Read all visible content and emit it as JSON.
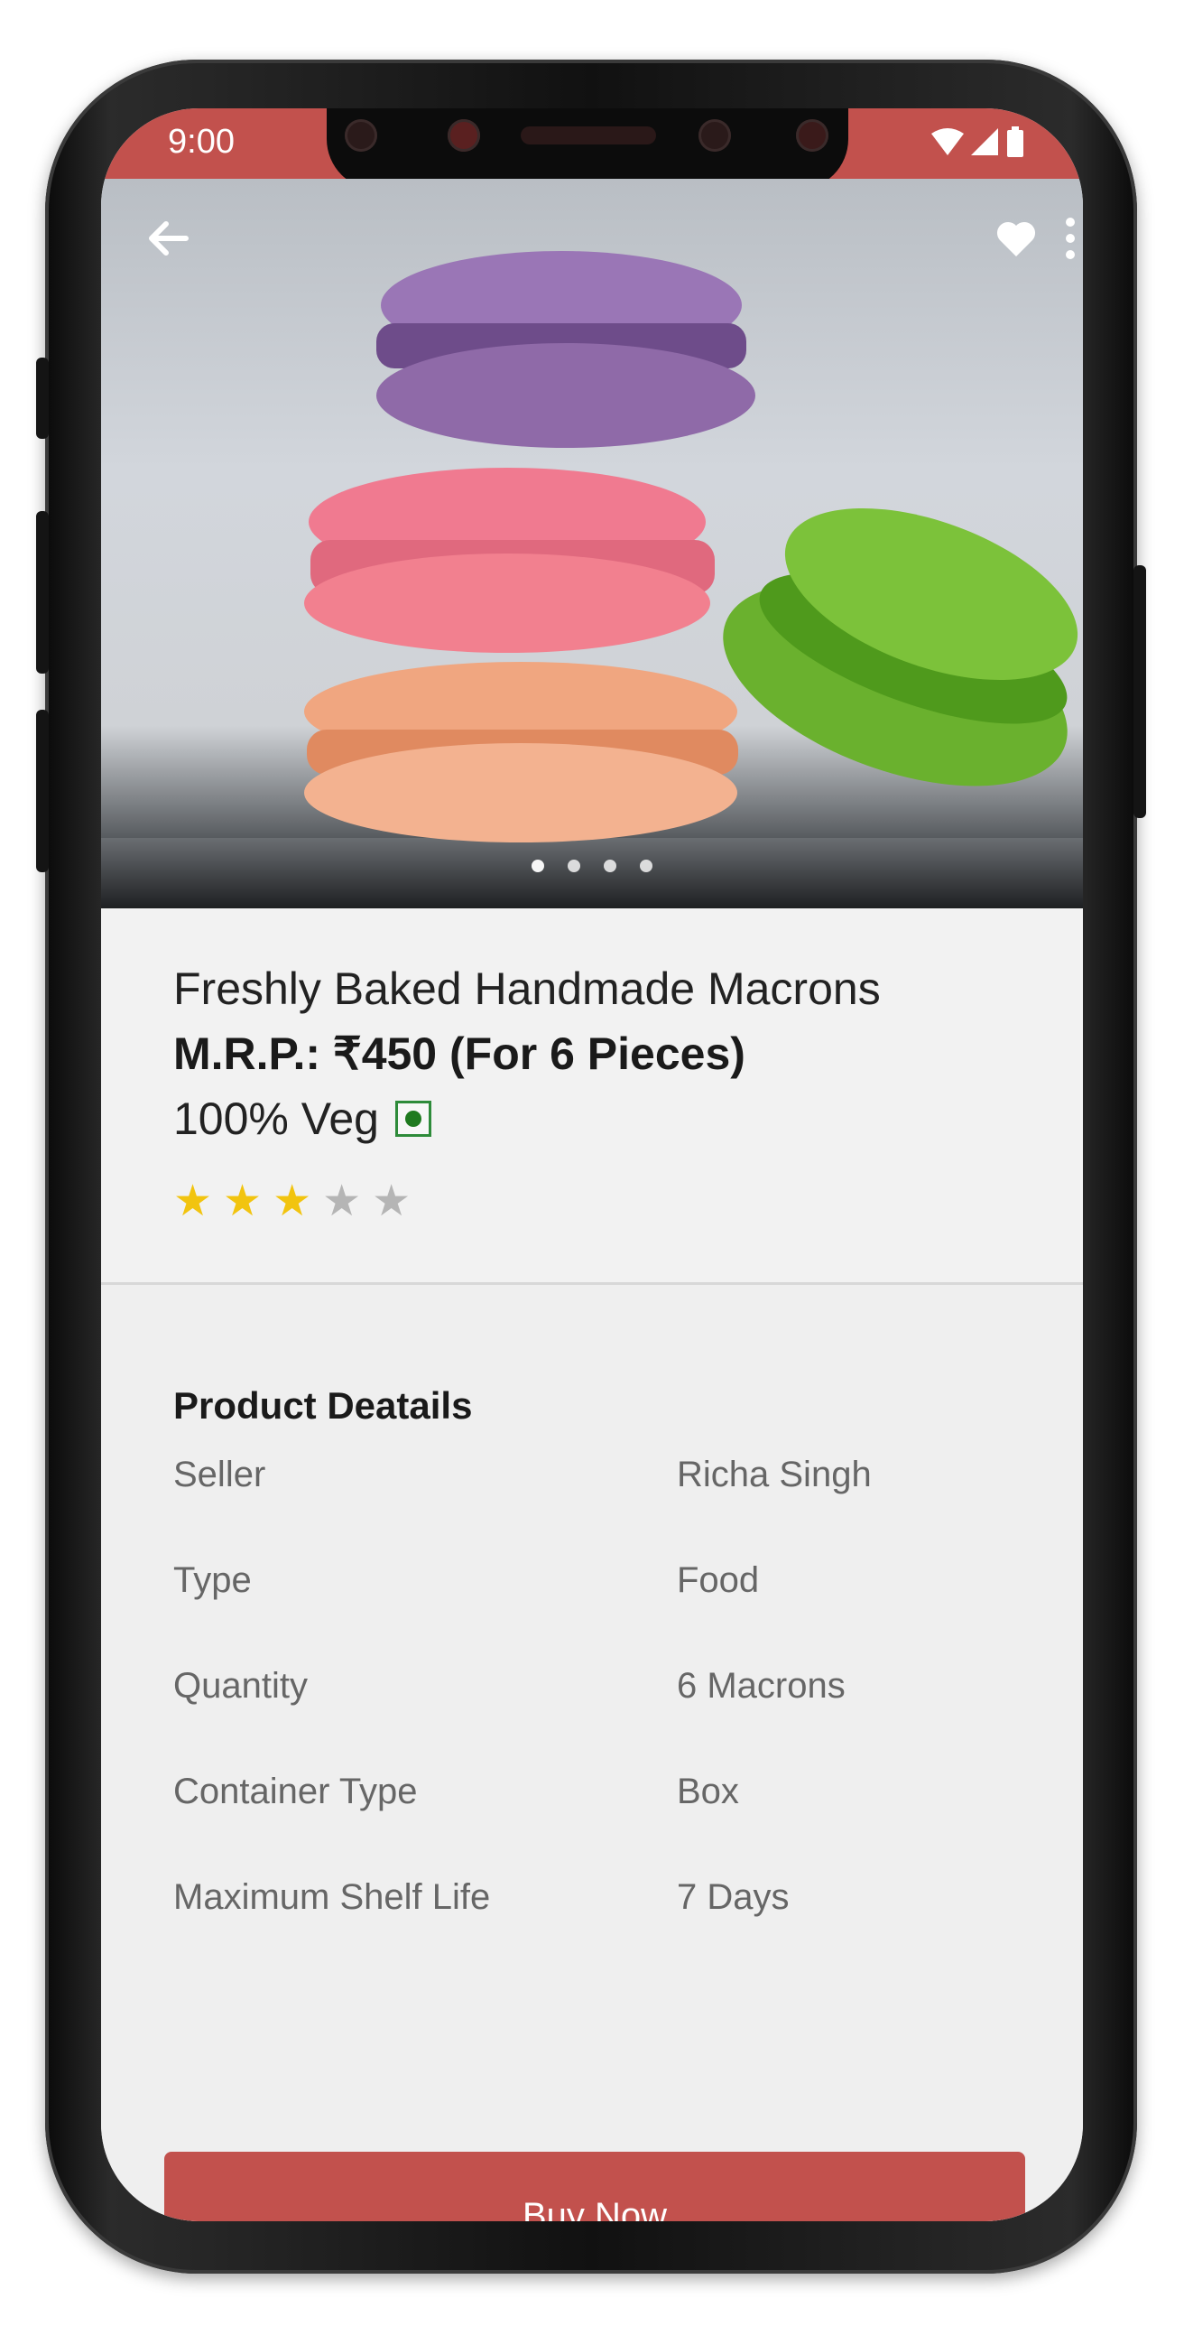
{
  "status_bar": {
    "time": "9:00"
  },
  "product": {
    "title": "Freshly Baked Handmade Macrons",
    "price": "M.R.P.: ₹450 (For 6 Pieces)",
    "veg": "100% Veg",
    "rating": {
      "value": 3,
      "max": 5
    },
    "gallery": {
      "total_images": 4,
      "current_index": 0
    }
  },
  "details": {
    "title": "Product Deatails",
    "rows": [
      {
        "label": "Seller",
        "value": "Richa Singh"
      },
      {
        "label": "Type",
        "value": "Food"
      },
      {
        "label": "Quantity",
        "value": "6 Macrons"
      },
      {
        "label": "Container Type",
        "value": "Box"
      },
      {
        "label": "Maximum Shelf Life",
        "value": "7 Days"
      }
    ]
  },
  "actions": {
    "buy_label": "Buy Now"
  },
  "icons": {
    "back": "arrow-left-icon",
    "favorite": "heart-icon",
    "more": "more-vertical-icon",
    "wifi": "wifi-icon",
    "signal": "signal-icon",
    "battery": "battery-icon"
  },
  "colors": {
    "accent": "#c2514d",
    "star_on": "#f2c40f",
    "star_off": "#b5b5b5",
    "veg": "#1f7a1f"
  }
}
